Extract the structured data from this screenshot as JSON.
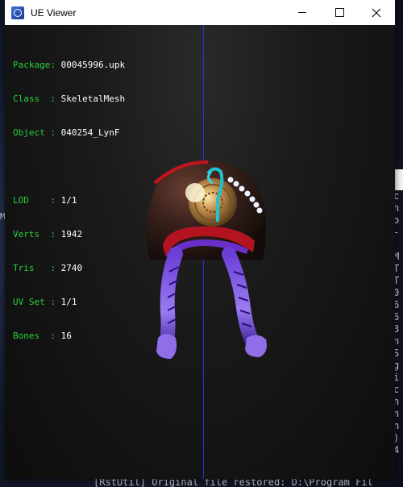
{
  "window": {
    "title": "UE Viewer",
    "controls": {
      "minimize": "minimize",
      "maximize": "maximize",
      "close": "close"
    }
  },
  "info": {
    "package_key": "Package:",
    "package": "00045996.upk",
    "class_key": "Class  :",
    "class": "SkeletalMesh",
    "object_key": "Object :",
    "object": "040254_LynF",
    "lod_key": "LOD    :",
    "lod": "1/1",
    "verts_key": "Verts  :",
    "verts": "1942",
    "tris_key": "Tris   :",
    "tris": "2740",
    "uvset_key": "UV Set :",
    "uvset": "1/1",
    "bones_key": "Bones  :",
    "bones": "16"
  },
  "background": {
    "console_chars": [
      "c",
      "h",
      "o",
      "-",
      "",
      "M",
      "T",
      "T",
      "0",
      "6",
      "6",
      "3",
      "n",
      "S",
      "g",
      "i",
      "c",
      "h",
      "n",
      "n",
      ")",
      "4"
    ],
    "left_char": "M",
    "bottom_log": "[RstUtil] Original file restored: D:\\Program Fil"
  },
  "colors": {
    "axis": "#1c35d6",
    "label": "#27d13a",
    "value": "#ffffff"
  }
}
